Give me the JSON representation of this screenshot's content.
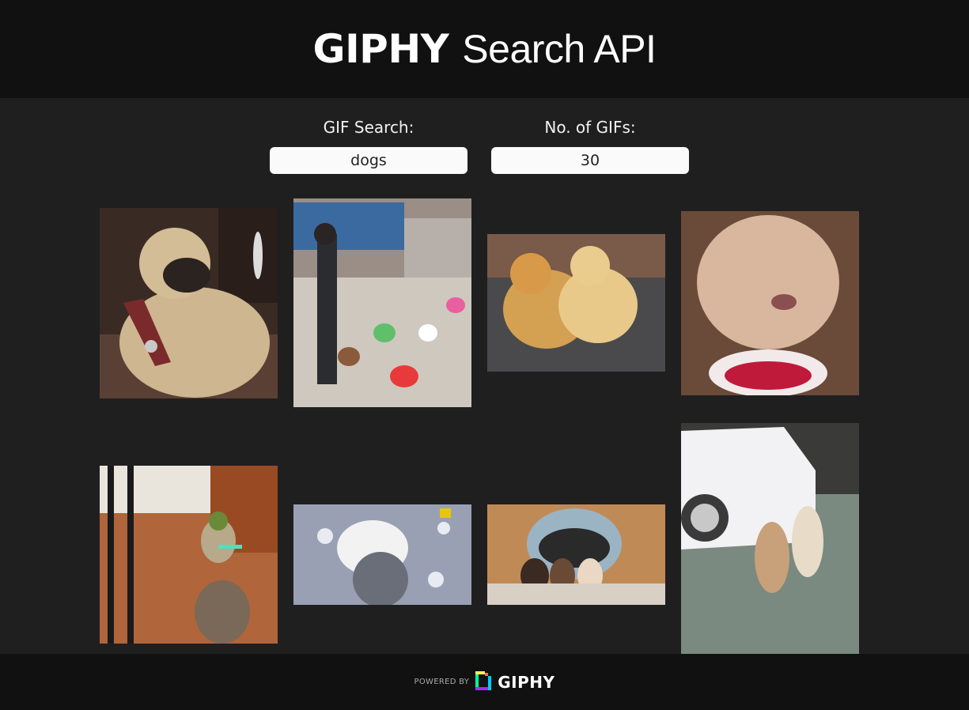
{
  "header": {
    "brand": "GIPHY",
    "rest": "Search API"
  },
  "search": {
    "label": "GIF Search:",
    "value": "dogs"
  },
  "count": {
    "label": "No. of GIFs:",
    "value": "30"
  },
  "gifs": [
    {
      "subject": "pug"
    },
    {
      "subject": "man with dancing poodles"
    },
    {
      "subject": "two golden retrievers"
    },
    {
      "subject": "labrador with cake"
    },
    {
      "subject": "yoda dog costume"
    },
    {
      "subject": "windblown crested dog"
    },
    {
      "subject": "puppies in dog bed"
    },
    {
      "subject": "two poodles dancing"
    }
  ],
  "footer": {
    "powered": "POWERED BY",
    "brand": "GIPHY"
  },
  "colors": {
    "header_bg": "#111111",
    "body_bg": "#1f1f1f",
    "input_bg": "#fafafa"
  }
}
